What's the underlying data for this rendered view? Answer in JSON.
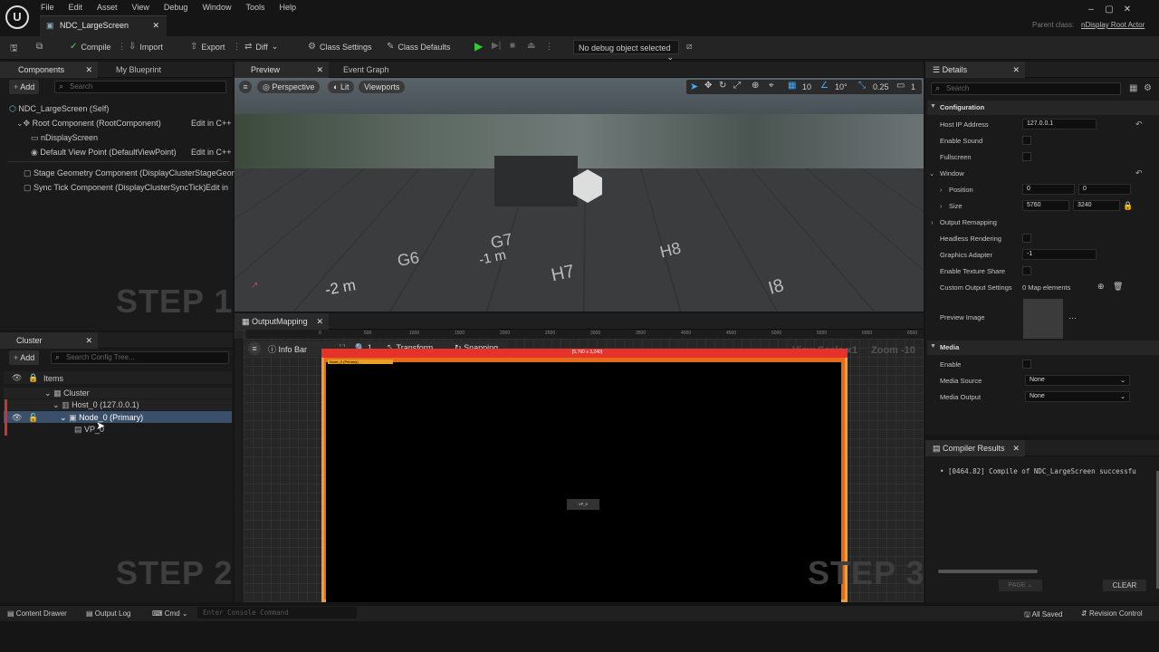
{
  "menu": [
    "File",
    "Edit",
    "Asset",
    "View",
    "Debug",
    "Window",
    "Tools",
    "Help"
  ],
  "tab_title": "NDC_LargeScreen",
  "parent_class_label": "Parent class:",
  "parent_class_value": "nDisplay Root Actor",
  "toolbar": {
    "compile": "Compile",
    "import": "Import",
    "export": "Export",
    "diff": "Diff",
    "class_settings": "Class Settings",
    "class_defaults": "Class Defaults",
    "debug_object": "No debug object selected"
  },
  "components": {
    "tab": "Components",
    "tab2": "My Blueprint",
    "add": "Add",
    "search_placeholder": "Search",
    "items": [
      {
        "label": "NDC_LargeScreen (Self)"
      },
      {
        "label": "Root Component (RootComponent)",
        "action": "Edit in C++"
      },
      {
        "label": "nDisplayScreen"
      },
      {
        "label": "Default View Point (DefaultViewPoint)",
        "action": "Edit in C++"
      },
      {
        "label": "Stage Geometry Component (DisplayClusterStageGeom"
      },
      {
        "label": "Sync Tick Component (DisplayClusterSyncTick)",
        "action": "Edit in"
      }
    ]
  },
  "steps": {
    "step1": "STEP 1",
    "step2": "STEP 2",
    "step3": "STEP 3"
  },
  "preview": {
    "tab": "Preview",
    "tab2": "Event Graph",
    "perspective": "Perspective",
    "lit": "Lit",
    "viewports": "Viewports",
    "grid_snap": "10",
    "rot_snap": "10°",
    "scale_snap": "0.25",
    "cam_speed": "1"
  },
  "cluster": {
    "tab": "Cluster",
    "add": "Add",
    "search_placeholder": "Search Config Tree...",
    "items_label": "Items",
    "cluster": "Cluster",
    "host": "Host_0 (127.0.0.1)",
    "node": "Node_0 (Primary)",
    "vp": "VP_0"
  },
  "output": {
    "tab": "OutputMapping",
    "info_bar": "Info Bar",
    "zoom_steps": "1",
    "transform": "Transform",
    "snapping": "Snapping",
    "view_scale": "View Scale x1",
    "zoom": "Zoom -10",
    "ruler": [
      "0",
      "500",
      "1000",
      "1500",
      "2000",
      "2500",
      "3000",
      "3500",
      "4000",
      "4500",
      "5000",
      "5500",
      "6000",
      "6500"
    ],
    "res_label": "[5,760 x 3,240]",
    "node_label": "Node_0 (Primary)",
    "vp_label": "VP_0"
  },
  "details": {
    "tab": "Details",
    "search_placeholder": "Search",
    "configuration": "Configuration",
    "host_ip_label": "Host IP Address",
    "host_ip": "127.0.0.1",
    "enable_sound": "Enable Sound",
    "fullscreen": "Fullscreen",
    "window": "Window",
    "position": "Position",
    "pos_x": "0",
    "pos_y": "0",
    "size": "Size",
    "size_w": "5760",
    "size_h": "3240",
    "output_remapping": "Output Remapping",
    "headless": "Headless Rendering",
    "graphics_adapter": "Graphics Adapter",
    "graphics_adapter_val": "-1",
    "texture_share": "Enable Texture Share",
    "custom_output": "Custom Output Settings",
    "custom_output_val": "0 Map elements",
    "preview_image": "Preview Image",
    "media": "Media",
    "enable": "Enable",
    "media_source": "Media Source",
    "media_source_val": "None",
    "media_output": "Media Output",
    "media_output_val": "None"
  },
  "compiler": {
    "tab": "Compiler Results",
    "message": "[0464.82] Compile of NDC_LargeScreen successfu",
    "page": "PAGE",
    "clear": "CLEAR"
  },
  "status": {
    "content_drawer": "Content Drawer",
    "output_log": "Output Log",
    "cmd": "Cmd",
    "console_placeholder": "Enter Console Command",
    "all_saved": "All Saved",
    "revision": "Revision Control"
  },
  "floor_labels": [
    "G7",
    "H8",
    "G6",
    "H7",
    "I8",
    "-1 m",
    "-2 m"
  ]
}
